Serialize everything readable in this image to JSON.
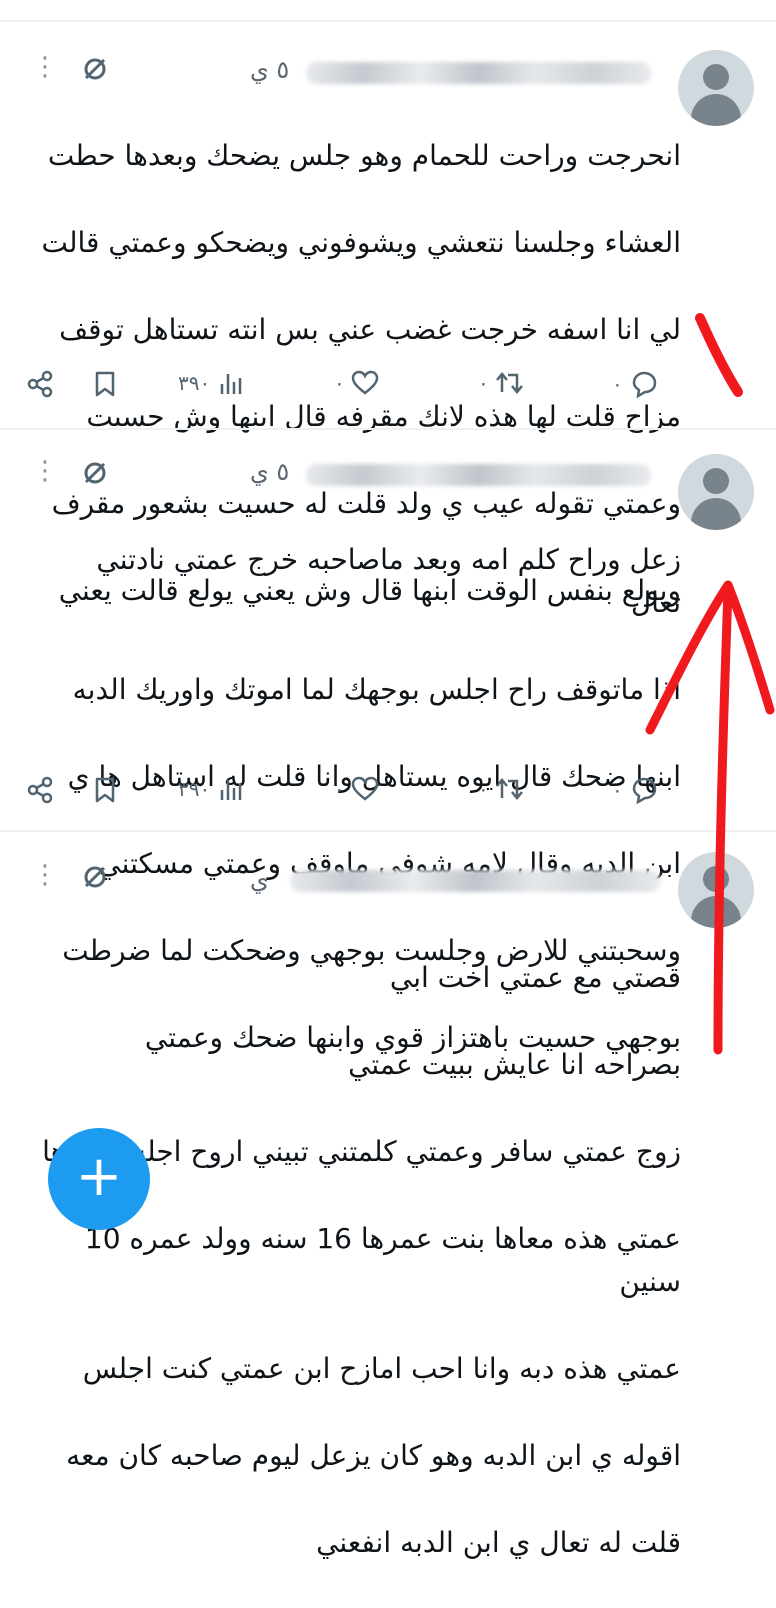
{
  "posts": [
    {
      "handle_suffix": "٥ ي",
      "lines": [
        "انحرجت وراحت للحمام وهو جلس يضحك وبعدها حطت",
        "العشاء وجلسنا نتعشي ويشوفوني ويضحكو وعمتي قالت",
        "لي انا اسفه خرجت غضب عني بس انته تستاهل توقف",
        "مزاح قلت لها هذه لانك مقرفه قال ابنها وش حسيت",
        "وعمتي تقوله عيب ي ولد قلت له حسيت بشعور مقرف",
        "ويولع بنفس الوقت ابنها قال وش يعني يولع قالت يعني"
      ],
      "views": "٣٩٠",
      "likes": "٠",
      "retweets": "٠",
      "replies": "٠"
    },
    {
      "handle_suffix": "٥ ي",
      "lines": [
        "زعل وراح كلم امه وبعد ماصاحبه خرج عمتي نادتني تعال",
        "اذا ماتوقف راح اجلس بوجهك لما اموتك واوريك الدبه",
        "ابنها ضحك قال ايوه يستاهل وانا قلت له استاهل ها ي",
        "ابن الدبه وقال لامه شوفي ماوقف وعمتي مسكتني",
        "وسحبتني للارض وجلست بوجهي وضحكت لما ضرطت",
        "بوجهي حسيت باهتزاز قوي وابنها ضحك وعمتي"
      ],
      "views": "٣٩٠",
      "likes": "٠",
      "retweets": "٠",
      "replies": "٠"
    },
    {
      "handle_suffix": "ي",
      "lines": [
        "قصتي مع عمتي اخت ابي",
        "بصراحه انا عايش ببيت عمتي",
        "زوج عمتي سافر وعمتي كلمتني تبيني اروح اجلس معاها",
        "عمتي هذه معاها بنت عمرها 16 سنه وولد عمره 10 سنين",
        "عمتي هذه دبه وانا احب امازح ابن عمتي كنت اجلس",
        "اقوله ي ابن الدبه وهو كان يزعل ليوم صاحبه كان معه",
        "قلت له تعال ي ابن الدبه انفعني"
      ]
    }
  ],
  "fab": {
    "label": "+"
  },
  "colors": {
    "accent": "#1d9bf0",
    "annotation": "#f0191e"
  }
}
